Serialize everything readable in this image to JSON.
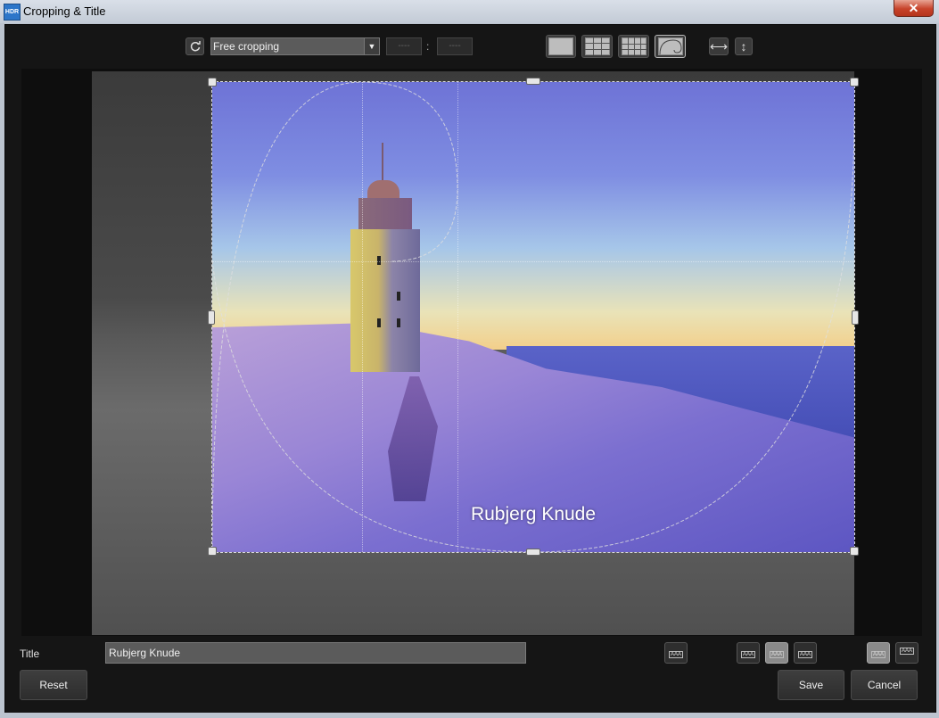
{
  "window": {
    "app_icon_text": "HDR",
    "title": "Cropping & Title",
    "close_glyph": "✕"
  },
  "toolbar": {
    "rotate_icon": "rotate-icon",
    "crop_mode": "Free cropping",
    "ratio_width_placeholder": "----",
    "ratio_height_placeholder": "----",
    "ratio_separator": ":",
    "grid_options": [
      "none-grid",
      "thirds-grid",
      "quarters-grid",
      "golden-spiral"
    ],
    "selected_grid": "golden-spiral",
    "flip_horizontal_glyph": "⟷",
    "flip_vertical_glyph": "↕"
  },
  "image": {
    "overlay_title": "Rubjerg Knude"
  },
  "controls": {
    "title_label": "Title",
    "title_value": "Rubjerg Knude",
    "font_button_text": "AAA",
    "position_options": [
      "AAA",
      "AAA",
      "AAA"
    ],
    "selected_position": 1,
    "placement_options": [
      "AAA",
      "AAA"
    ],
    "selected_placement": 0,
    "reset_label": "Reset",
    "save_label": "Save",
    "cancel_label": "Cancel"
  },
  "colors": {
    "background": "#151515",
    "button": "#2e2e2e",
    "active_button": "#8a8a8a"
  }
}
